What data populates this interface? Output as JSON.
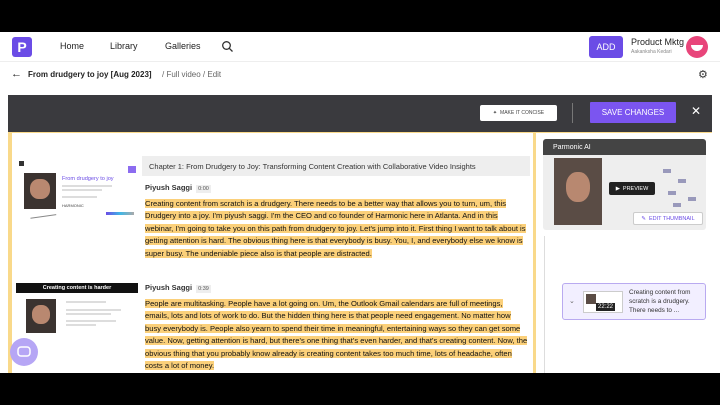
{
  "nav": {
    "logo": "P",
    "links": [
      "Home",
      "Library",
      "Galleries"
    ],
    "add_label": "ADD",
    "user_name": "Product Mktg",
    "user_sub": "Aakanksha Kedari"
  },
  "breadcrumb": {
    "title": "From drudgery to joy [Aug 2023]",
    "rest": "/ Full video / Edit"
  },
  "editor_bar": {
    "concise_label": "MAKE IT CONCISE",
    "save_label": "SAVE CHANGES"
  },
  "thumbnails": {
    "first_title": "From drudgery to joy",
    "first_sub": "HARMONIC",
    "second_heading": "Creating content is harder"
  },
  "transcript": {
    "chapter": "Chapter 1: From Drudgery to Joy: Transforming Content Creation with Collaborative Video Insights",
    "blocks": [
      {
        "speaker": "Piyush Saggi",
        "time": "0:00",
        "text": "Creating content from scratch is a drudgery. There needs to be a better way that allows you to turn, um, this Drudgery into a joy. I'm piyush saggi. I'm the CEO and co founder of Harmonic here in Atlanta. And in this webinar, I'm going to take you on this path from drudgery to joy. Let's jump into it. First thing I want to talk about is getting attention is hard. The obvious thing here is that everybody is busy. You, I, and everybody else we know is super busy. The undeniable piece also is that people are distracted."
      },
      {
        "speaker": "Piyush Saggi",
        "time": "0:39",
        "text": "People are multitasking. People have a lot going on. Um, the Outlook Gmail calendars are full of meetings, emails, lots and lots of work to do. But the hidden thing here is that people need engagement. No matter how busy everybody is. People also yearn to spend their time in meaningful, entertaining ways so they can get some value. Now, getting attention is hard, but there's one thing that's even harder, and that's creating content. Now, the obvious thing that you probably know already is creating content takes too much time, lots of headache, often costs a lot of money."
      }
    ]
  },
  "preview": {
    "title": "Parmonic AI",
    "preview_label": "PREVIEW",
    "edit_label": "EDIT THUMBNAIL"
  },
  "clip": {
    "time": "22:22",
    "text": "Creating content from scratch is a drudgery. There needs to ..."
  },
  "colors": {
    "accent": "#7b55f0",
    "highlight": "#fbd07a",
    "panel": "#f9d98a"
  }
}
